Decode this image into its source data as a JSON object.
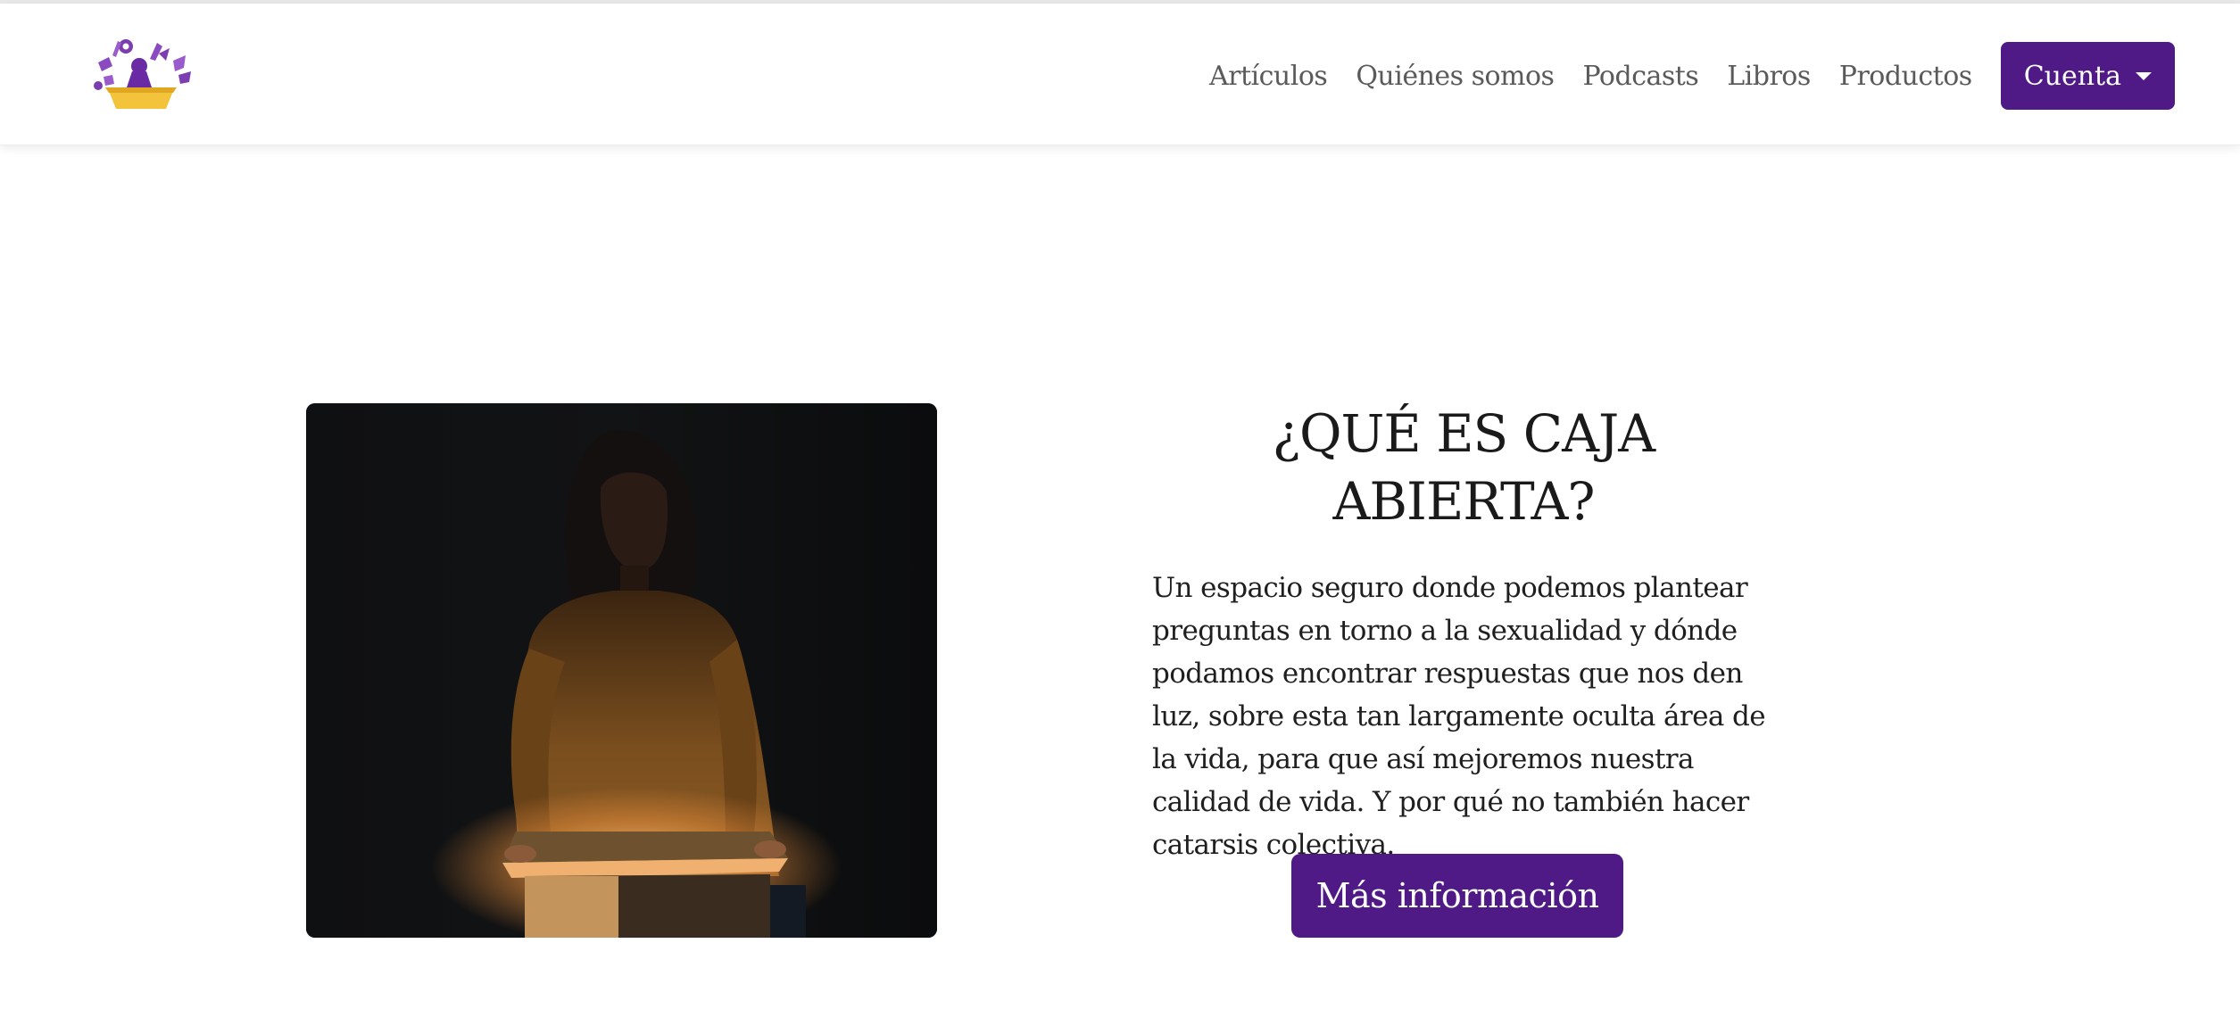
{
  "nav": {
    "logo_icon": "open-box-logo",
    "links": [
      "Artículos",
      "Quiénes somos",
      "Podcasts",
      "Libros",
      "Productos"
    ],
    "account_label": "Cuenta"
  },
  "hero": {
    "image_icon": "woman-opening-glowing-box-photo",
    "title": "¿QUÉ ES CAJA ABIERTA?",
    "description": "Un espacio seguro donde podemos plantear preguntas en torno a la sexualidad y dónde podamos encontrar respuestas que nos den luz, sobre esta tan largamente oculta área de la vida, para que así mejoremos nuestra calidad de vida. Y por qué no también hacer catarsis colectiva.",
    "button_label": "Más información"
  },
  "colors": {
    "brand_purple": "#501a86",
    "logo_yellow": "#f3c33c",
    "logo_purple": "#7b3db0",
    "text_dark": "#1f1f1f",
    "nav_text": "#5a5a5a"
  }
}
